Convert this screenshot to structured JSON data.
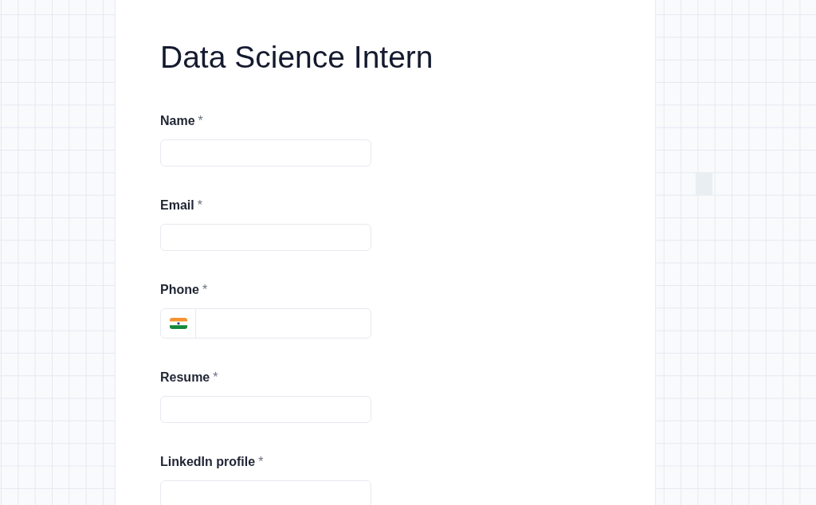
{
  "title": "Data Science Intern",
  "fields": [
    {
      "kind": "text",
      "label": "Name",
      "required_mark": "*"
    },
    {
      "kind": "text",
      "label": "Email",
      "required_mark": "*"
    },
    {
      "kind": "phone",
      "label": "Phone",
      "required_mark": "*"
    },
    {
      "kind": "text",
      "label": "Resume",
      "required_mark": "*"
    },
    {
      "kind": "text",
      "label": "LinkedIn profile",
      "required_mark": "*"
    }
  ]
}
